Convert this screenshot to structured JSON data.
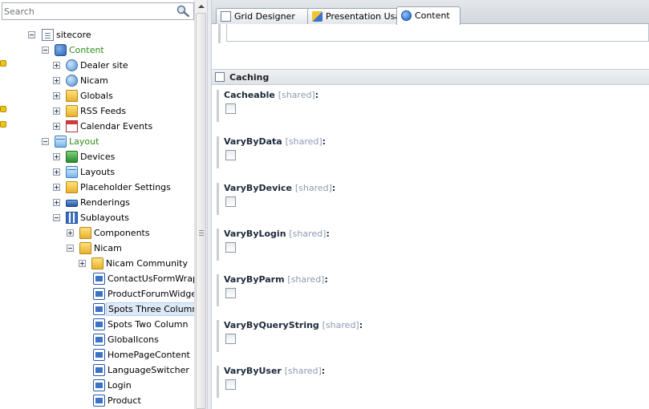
{
  "search": {
    "placeholder": "Search"
  },
  "tree": {
    "items": [
      {
        "label": "sitecore",
        "icon": "document-icon"
      },
      {
        "label": "Content",
        "icon": "content-icon"
      },
      {
        "label": "Dealer site",
        "icon": "website-icon"
      },
      {
        "label": "Nicam",
        "icon": "website-icon"
      },
      {
        "label": "Globals",
        "icon": "folder-icon"
      },
      {
        "label": "RSS Feeds",
        "icon": "folder-icon"
      },
      {
        "label": "Calendar Events",
        "icon": "calendar-icon"
      },
      {
        "label": "Layout",
        "icon": "layout-icon"
      },
      {
        "label": "Devices",
        "icon": "device-icon"
      },
      {
        "label": "Layouts",
        "icon": "layout-icon"
      },
      {
        "label": "Placeholder Settings",
        "icon": "folder-icon"
      },
      {
        "label": "Renderings",
        "icon": "rendering-icon"
      },
      {
        "label": "Sublayouts",
        "icon": "sublayouts-icon"
      },
      {
        "label": "Components",
        "icon": "folder-icon"
      },
      {
        "label": "Nicam",
        "icon": "folder-icon"
      },
      {
        "label": "Nicam Community",
        "icon": "folder-icon"
      },
      {
        "label": "ContactUsFormWrappe",
        "icon": "sublayout-icon"
      },
      {
        "label": "ProductForumWidget",
        "icon": "sublayout-icon"
      },
      {
        "label": "Spots Three Column",
        "icon": "sublayout-icon",
        "selected": true
      },
      {
        "label": "Spots Two Column",
        "icon": "sublayout-icon"
      },
      {
        "label": "GlobalIcons",
        "icon": "sublayout-icon"
      },
      {
        "label": "HomePageContent",
        "icon": "sublayout-icon"
      },
      {
        "label": "LanguageSwitcher",
        "icon": "sublayout-icon"
      },
      {
        "label": "Login",
        "icon": "sublayout-icon"
      },
      {
        "label": "Product",
        "icon": "sublayout-icon"
      }
    ]
  },
  "tabs": [
    {
      "label": "Grid Designer",
      "icon": "grid-designer-icon"
    },
    {
      "label": "Presentation Usage",
      "icon": "presentation-icon"
    },
    {
      "label": "Content",
      "icon": "content-tab-icon",
      "active": true
    }
  ],
  "section": {
    "title": "Caching"
  },
  "fields": [
    {
      "name": "Cacheable",
      "tag": "[shared]",
      "checked": false
    },
    {
      "name": "VaryByData",
      "tag": "[shared]",
      "checked": false
    },
    {
      "name": "VaryByDevice",
      "tag": "[shared]",
      "checked": false
    },
    {
      "name": "VaryByLogin",
      "tag": "[shared]",
      "checked": false
    },
    {
      "name": "VaryByParm",
      "tag": "[shared]",
      "checked": false
    },
    {
      "name": "VaryByQueryString",
      "tag": "[shared]",
      "checked": false
    },
    {
      "name": "VaryByUser",
      "tag": "[shared]",
      "checked": false
    }
  ],
  "colors": {
    "marker": "#f0c419",
    "green_label": "#2e8b1a",
    "selected_bg": "#dde9f7"
  }
}
